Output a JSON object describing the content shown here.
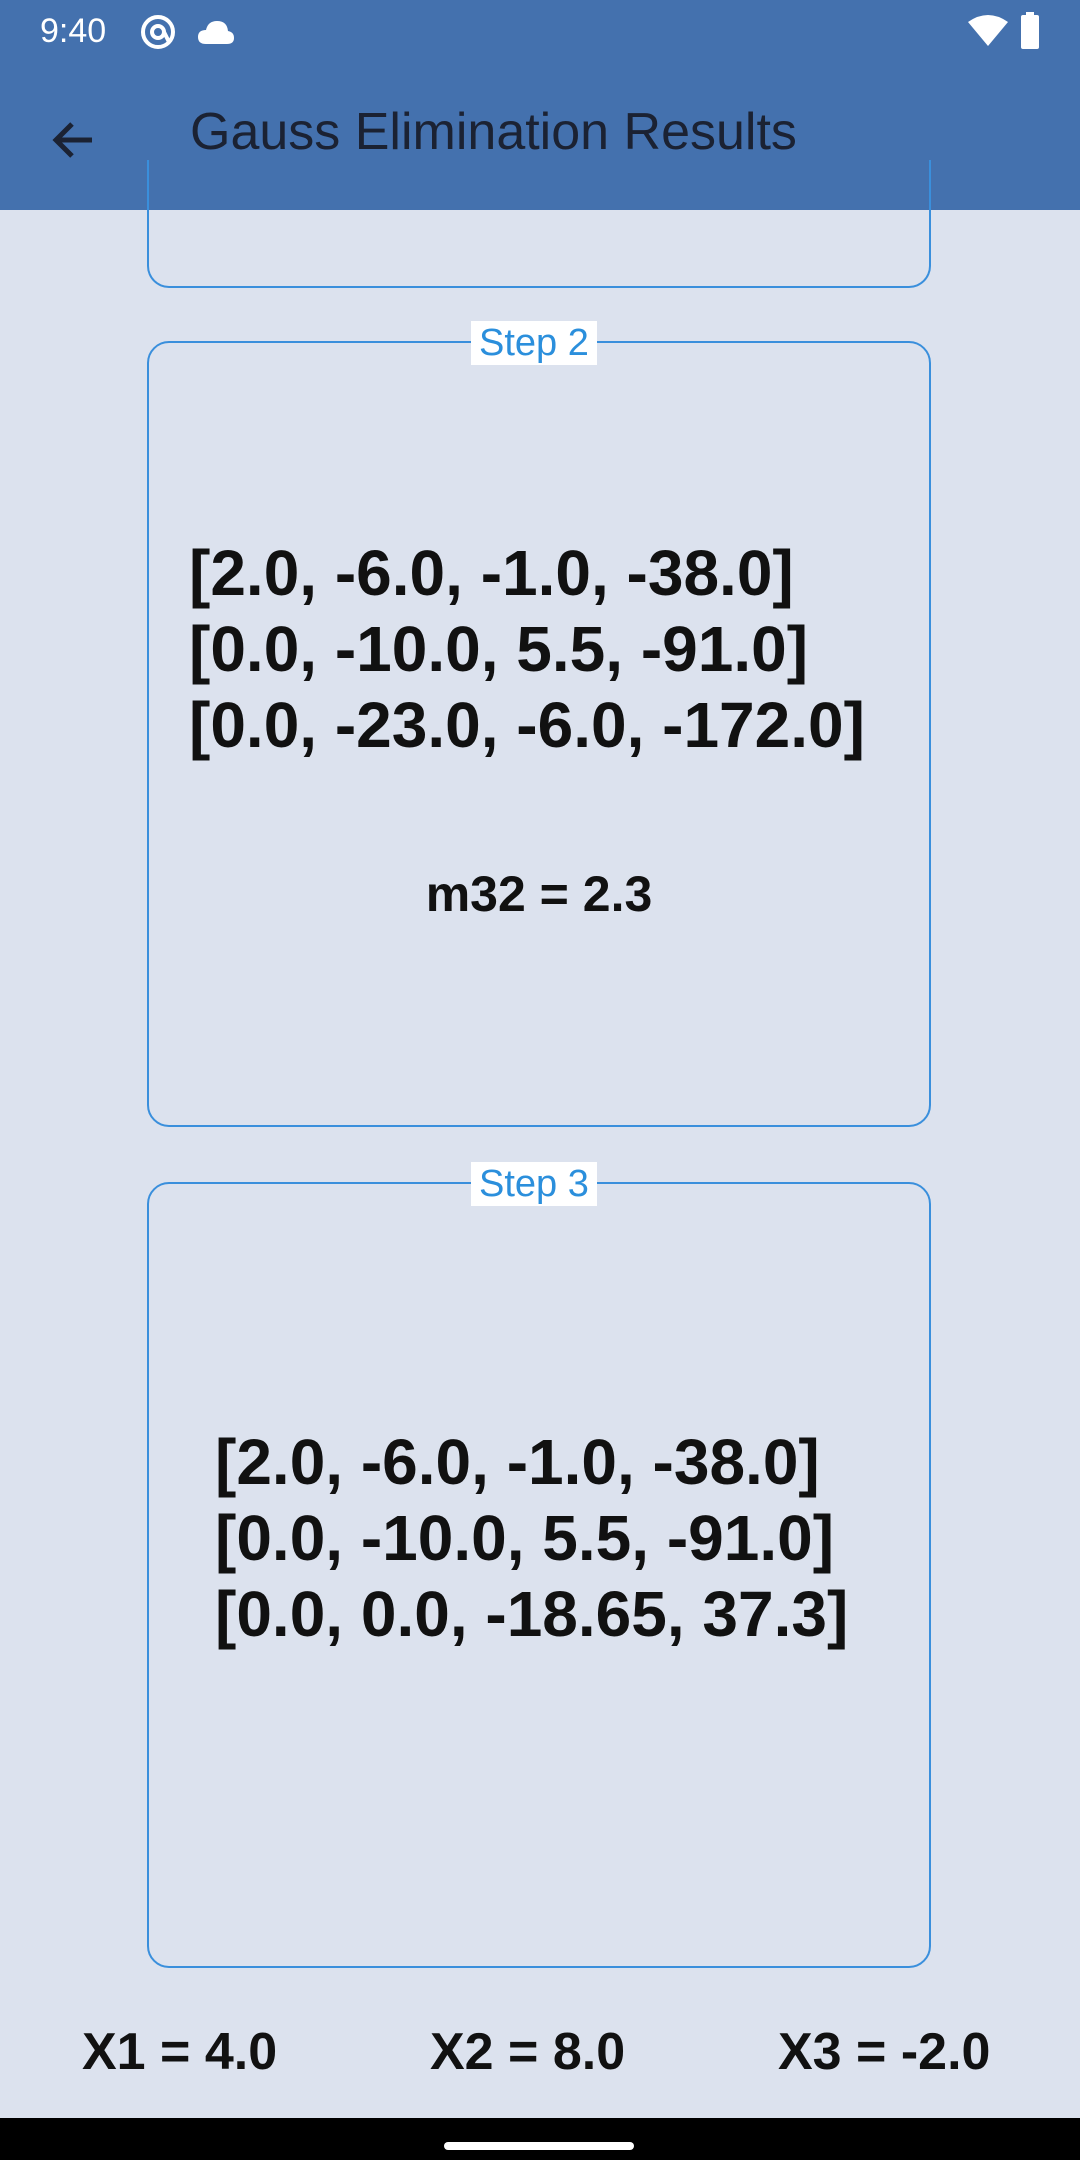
{
  "status_bar": {
    "time": "9:40",
    "icons": [
      "at-sign-icon",
      "cloud-icon",
      "wifi-icon",
      "battery-icon"
    ]
  },
  "app_bar": {
    "title": "Gauss Elimination Results",
    "back_icon": "arrow-left-icon"
  },
  "colors": {
    "app_bar": "#4471ae",
    "background": "#dce2ee",
    "card_border": "#3a8fdc",
    "legend_text": "#2b8fdc"
  },
  "steps": [
    {
      "label": "Step 2",
      "rows": [
        "[2.0, -6.0, -1.0, -38.0]",
        "[0.0, -10.0, 5.5, -91.0]",
        "[0.0, -23.0, -6.0, -172.0]"
      ],
      "multiplier": "m32 = 2.3"
    },
    {
      "label": "Step 3",
      "rows": [
        "[2.0, -6.0, -1.0, -38.0]",
        "[0.0, -10.0, 5.5, -91.0]",
        "[0.0, 0.0, -18.65, 37.3]"
      ]
    }
  ],
  "results": {
    "x1": "X1 = 4.0",
    "x2": "X2 = 8.0",
    "x3": "X3 = -2.0"
  }
}
